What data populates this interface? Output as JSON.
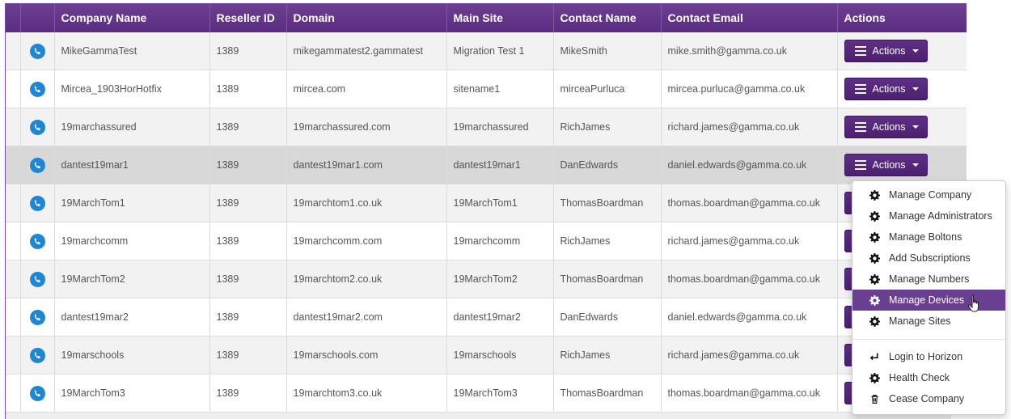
{
  "table": {
    "columns": [
      "Company Name",
      "Reseller ID",
      "Domain",
      "Main Site",
      "Contact Name",
      "Contact Email",
      "Actions"
    ],
    "action_label": "Actions",
    "rows": [
      {
        "company": "MikeGammaTest",
        "reseller_id": "1389",
        "domain": "mikegammatest2.gammatest",
        "main_site": "Migration Test 1",
        "contact_name": "MikeSmith",
        "contact_email": "mike.smith@gamma.co.uk"
      },
      {
        "company": "Mircea_1903HorHotfix",
        "reseller_id": "1389",
        "domain": "mircea.com",
        "main_site": "sitename1",
        "contact_name": "mirceaPurluca",
        "contact_email": "mircea.purluca@gamma.co.uk"
      },
      {
        "company": "19marchassured",
        "reseller_id": "1389",
        "domain": "19marchassured.com",
        "main_site": "19marchassured",
        "contact_name": "RichJames",
        "contact_email": "richard.james@gamma.co.uk"
      },
      {
        "company": "dantest19mar1",
        "reseller_id": "1389",
        "domain": "dantest19mar1.com",
        "main_site": "dantest19mar1",
        "contact_name": "DanEdwards",
        "contact_email": "daniel.edwards@gamma.co.uk"
      },
      {
        "company": "19MarchTom1",
        "reseller_id": "1389",
        "domain": "19marchtom1.co.uk",
        "main_site": "19MarchTom1",
        "contact_name": "ThomasBoardman",
        "contact_email": "thomas.boardman@gamma.co.uk"
      },
      {
        "company": "19marchcomm",
        "reseller_id": "1389",
        "domain": "19marchcomm.com",
        "main_site": "19marchcomm",
        "contact_name": "RichJames",
        "contact_email": "richard.james@gamma.co.uk"
      },
      {
        "company": "19MarchTom2",
        "reseller_id": "1389",
        "domain": "19marchtom2.co.uk",
        "main_site": "19MarchTom2",
        "contact_name": "ThomasBoardman",
        "contact_email": "thomas.boardman@gamma.co.uk"
      },
      {
        "company": "dantest19mar2",
        "reseller_id": "1389",
        "domain": "dantest19mar2.com",
        "main_site": "dantest19mar2",
        "contact_name": "DanEdwards",
        "contact_email": "daniel.edwards@gamma.co.uk"
      },
      {
        "company": "19marschools",
        "reseller_id": "1389",
        "domain": "19marschools.com",
        "main_site": "19marschools",
        "contact_name": "RichJames",
        "contact_email": "richard.james@gamma.co.uk"
      },
      {
        "company": "19MarchTom3",
        "reseller_id": "1389",
        "domain": "19marchtom3.co.uk",
        "main_site": "19MarchTom3",
        "contact_name": "ThomasBoardman",
        "contact_email": "thomas.boardman@gamma.co.uk"
      }
    ]
  },
  "dropdown": {
    "group1": [
      {
        "label": "Manage Company",
        "icon": "gear-icon"
      },
      {
        "label": "Manage Administrators",
        "icon": "gear-icon"
      },
      {
        "label": "Manage Boltons",
        "icon": "gear-icon"
      },
      {
        "label": "Add Subscriptions",
        "icon": "gear-icon"
      },
      {
        "label": "Manage Numbers",
        "icon": "gear-icon"
      },
      {
        "label": "Manage Devices",
        "icon": "gear-icon"
      },
      {
        "label": "Manage Sites",
        "icon": "gear-icon"
      }
    ],
    "group2": [
      {
        "label": "Login to Horizon",
        "icon": "login-arrow-icon"
      },
      {
        "label": "Health Check",
        "icon": "gear-icon"
      },
      {
        "label": "Cease Company",
        "icon": "trash-icon"
      }
    ]
  },
  "colors": {
    "header_purple": "#5a2d80",
    "button_purple": "#4c2070",
    "active_item": "#6a3f92",
    "phone_blue": "#1f86d6"
  }
}
